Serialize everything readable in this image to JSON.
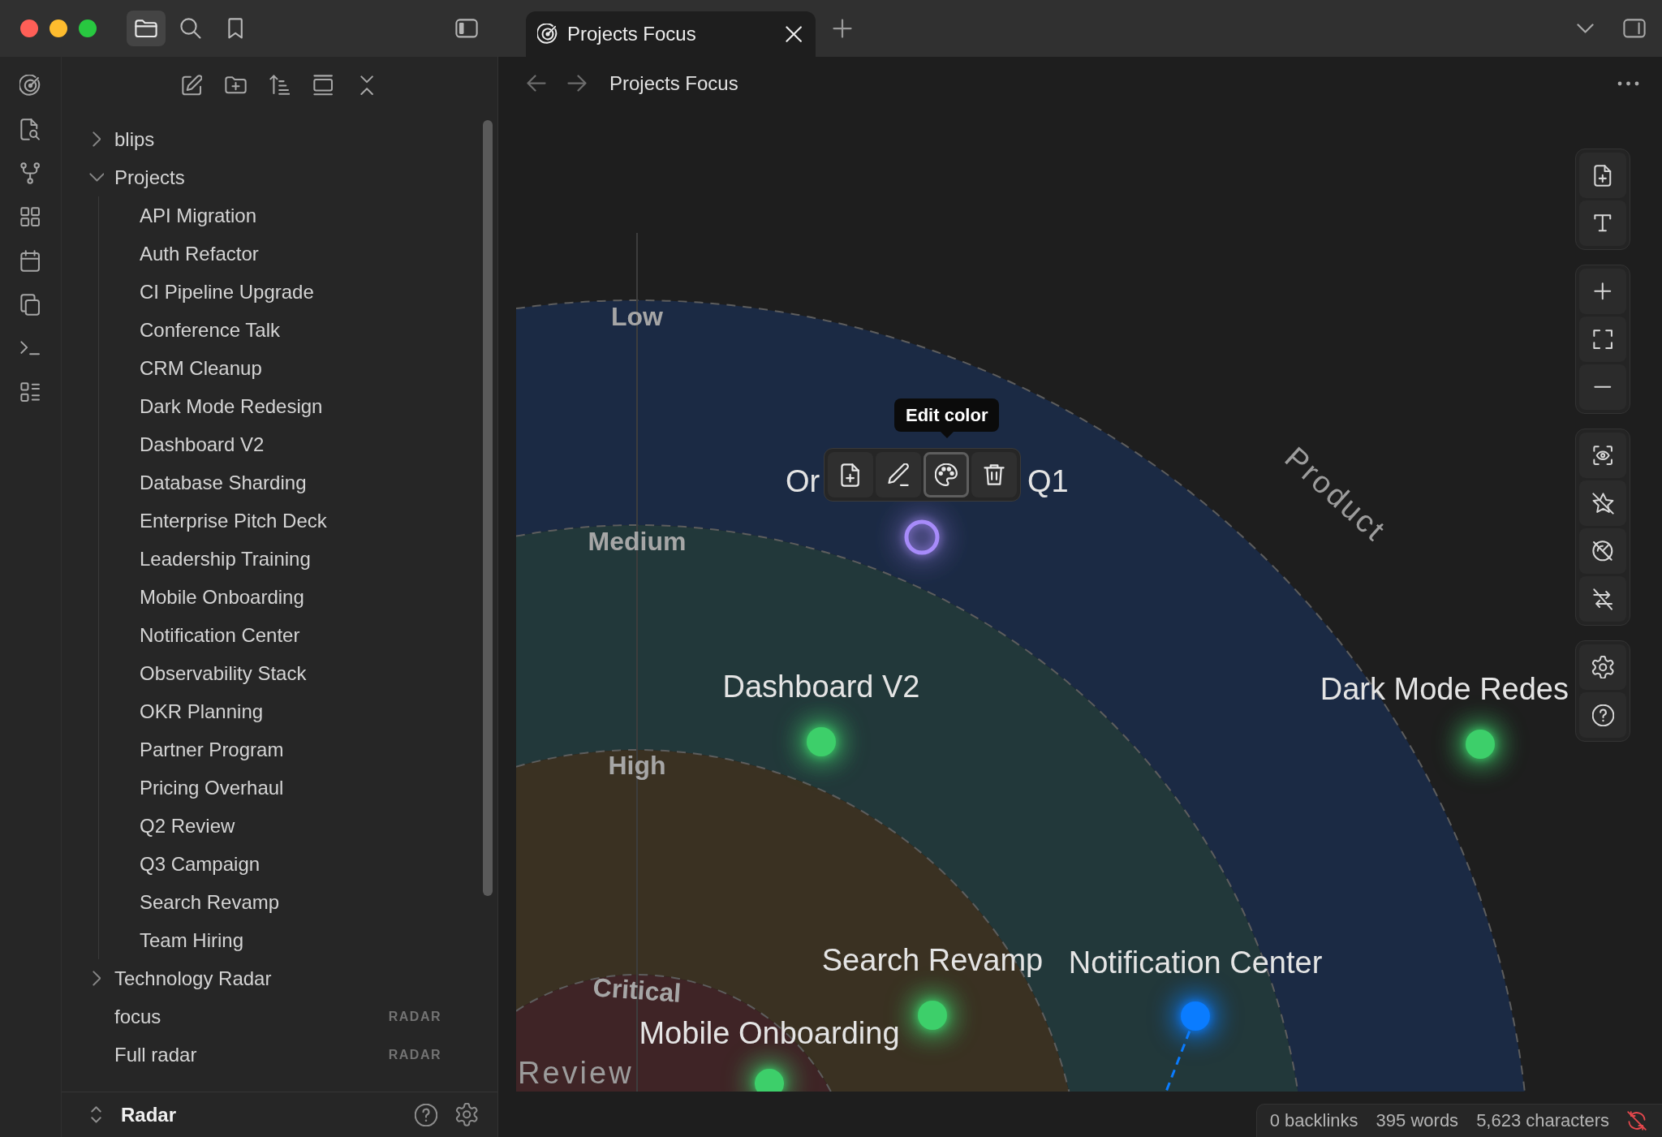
{
  "sidebar_tabs": [
    {
      "kind": "files",
      "selected": true
    },
    {
      "kind": "search",
      "selected": false
    },
    {
      "kind": "bookmarks",
      "selected": false
    }
  ],
  "tabs": [
    {
      "title": "Projects Focus",
      "selected": true
    }
  ],
  "file_tree": [
    {
      "kind": "folder",
      "label": "blips",
      "expanded": false
    },
    {
      "kind": "folder",
      "label": "Projects",
      "expanded": true,
      "children": [
        {
          "label": "API Migration"
        },
        {
          "label": "Auth Refactor"
        },
        {
          "label": "CI Pipeline Upgrade"
        },
        {
          "label": "Conference Talk"
        },
        {
          "label": "CRM Cleanup"
        },
        {
          "label": "Dark Mode Redesign"
        },
        {
          "label": "Dashboard V2"
        },
        {
          "label": "Database Sharding"
        },
        {
          "label": "Enterprise Pitch Deck"
        },
        {
          "label": "Leadership Training"
        },
        {
          "label": "Mobile Onboarding"
        },
        {
          "label": "Notification Center"
        },
        {
          "label": "Observability Stack"
        },
        {
          "label": "OKR Planning"
        },
        {
          "label": "Partner Program"
        },
        {
          "label": "Pricing Overhaul"
        },
        {
          "label": "Q2 Review"
        },
        {
          "label": "Q3 Campaign"
        },
        {
          "label": "Search Revamp"
        },
        {
          "label": "Team Hiring"
        }
      ]
    },
    {
      "kind": "folder",
      "label": "Technology Radar",
      "expanded": false
    },
    {
      "kind": "file",
      "label": "focus",
      "badge": "RADAR"
    },
    {
      "kind": "file",
      "label": "Full radar",
      "badge": "RADAR"
    }
  ],
  "sidebar_footer": {
    "title": "Radar"
  },
  "editor": {
    "title": "Projects Focus"
  },
  "radar": {
    "rings": [
      {
        "label": "Low",
        "color": "#1b2a44"
      },
      {
        "label": "Medium",
        "color": "#22383a"
      },
      {
        "label": "High",
        "color": "#3a3122"
      },
      {
        "label": "Critical",
        "color": "#3f2426"
      }
    ],
    "sectors": [
      {
        "label": "Product"
      },
      {
        "label": "Review"
      }
    ],
    "nodes": [
      {
        "label": "Or",
        "label_end": "Q1",
        "color": "#a78bfa",
        "selected": true,
        "linked": false
      },
      {
        "label": "Dashboard V2",
        "color": "#3dcf6a",
        "selected": false,
        "linked": false
      },
      {
        "label": "Dark Mode Redes",
        "color": "#3dcf6a",
        "selected": false,
        "linked": false
      },
      {
        "label": "Search Revamp",
        "color": "#3dcf6a",
        "selected": false,
        "linked": false
      },
      {
        "label": "Notification Center",
        "color": "#0a7cff",
        "selected": false,
        "linked": true
      },
      {
        "label": "Mobile Onboarding",
        "color": "#3dcf6a",
        "selected": false,
        "linked": false
      }
    ],
    "node_toolbar": {
      "tooltip": "Edit color",
      "buttons": [
        {
          "kind": "add-note",
          "selected": false
        },
        {
          "kind": "edit",
          "selected": false
        },
        {
          "kind": "color",
          "selected": true
        },
        {
          "kind": "delete",
          "selected": false
        }
      ]
    }
  },
  "status_bar": {
    "items": [
      "0 backlinks",
      "395 words",
      "5,623 characters"
    ]
  }
}
